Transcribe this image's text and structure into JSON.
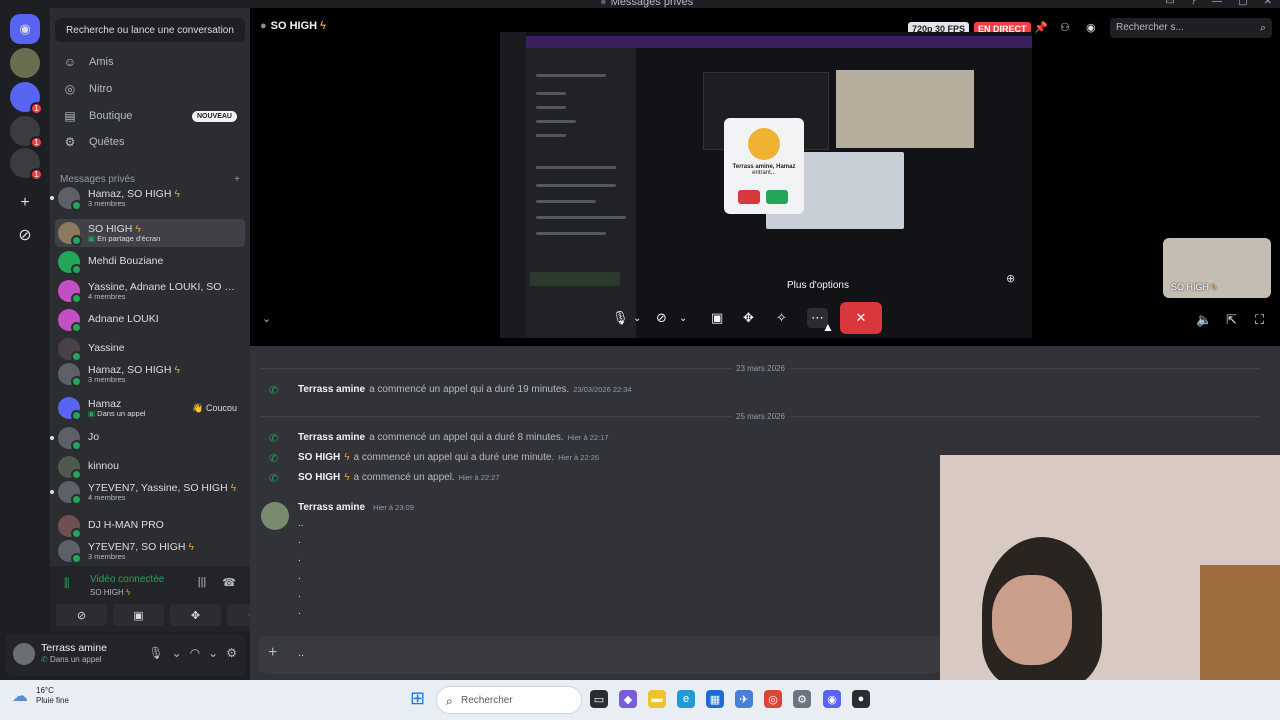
{
  "window": {
    "title": "Messages privés"
  },
  "dm_sidebar": {
    "search_label": "Recherche ou lance une conversation",
    "nav": [
      {
        "label": "Amis",
        "icon": "friends-icon"
      },
      {
        "label": "Nitro",
        "icon": "nitro-icon"
      },
      {
        "label": "Boutique",
        "icon": "shop-icon",
        "badge": "NOUVEAU"
      },
      {
        "label": "Quêtes",
        "icon": "quests-icon"
      }
    ],
    "section_title": "Messages privés",
    "section_add": "+",
    "dms": [
      {
        "name": "Hamaz, SO HIGH",
        "sub": "3 membres",
        "bolt": true
      },
      {
        "name": "SO HIGH",
        "sub": "En partage d'écran",
        "bolt": true,
        "active": true
      },
      {
        "name": "Mehdi Bouziane",
        "sub": ""
      },
      {
        "name": "Yassine, Adnane LOUKI, SO HIG...",
        "sub": "4 membres"
      },
      {
        "name": "Adnane LOUKI",
        "sub": ""
      },
      {
        "name": "Yassine",
        "sub": ""
      },
      {
        "name": "Hamaz, SO HIGH",
        "sub": "3 membres",
        "bolt": true
      },
      {
        "name": "Hamaz",
        "sub": "Dans un appel",
        "status": "👋 Coucou"
      },
      {
        "name": "Jo",
        "sub": ""
      },
      {
        "name": "kinnou",
        "sub": ""
      },
      {
        "name": "Y7EVEN7, Yassine, SO HIGH",
        "sub": "4 membres",
        "bolt": true
      },
      {
        "name": "DJ H-MAN PRO",
        "sub": ""
      },
      {
        "name": "Y7EVEN7, SO HIGH",
        "sub": "3 membres",
        "bolt": true
      }
    ]
  },
  "voice_panel": {
    "title": "Vidéo connectée",
    "channel": "SO HIGH"
  },
  "user_panel": {
    "name": "Terrass amine",
    "status": "Dans un appel"
  },
  "stream": {
    "title": "SO HIGH",
    "quality": "720p 30 FPS",
    "live": "EN DIRECT",
    "search_placeholder": "Rechercher s...",
    "tooltip": "Plus d'options",
    "pip_label": "SO HIGH",
    "shared_screen": {
      "caller_name": "Terrass amine, Hamaz",
      "caller_sub": "entrant..."
    }
  },
  "chat": {
    "dates": [
      "23 mars 2026",
      "25 mars 2026"
    ],
    "messages": [
      {
        "author": "Terrass amine",
        "text": "a commencé un appel qui a duré 19 minutes.",
        "time": "23/03/2026 22:34",
        "bolt": false
      },
      {
        "author": "Terrass amine",
        "text": "a commencé un appel qui a duré 8 minutes.",
        "time": "Hier à 22:17",
        "bolt": false
      },
      {
        "author": "SO HIGH",
        "text": "a commencé un appel qui a duré une minute.",
        "time": "Hier à 22:26",
        "bolt": true
      },
      {
        "author": "SO HIGH",
        "text": "a commencé un appel.",
        "time": "Hier à 22:27",
        "bolt": true
      }
    ],
    "last_author": "Terrass amine",
    "last_time": "Hier à 23:09",
    "last_lines": [
      "..",
      ".",
      ".",
      ".",
      ".",
      "."
    ],
    "composer_value": ".."
  },
  "taskbar": {
    "temp": "16°C",
    "weather": "Pluie fine",
    "search": "Rechercher"
  },
  "colors": {
    "accent": "#5865f2",
    "live_red": "#f23f43",
    "online_green": "#23a55a",
    "bolt": "#f0a232"
  }
}
